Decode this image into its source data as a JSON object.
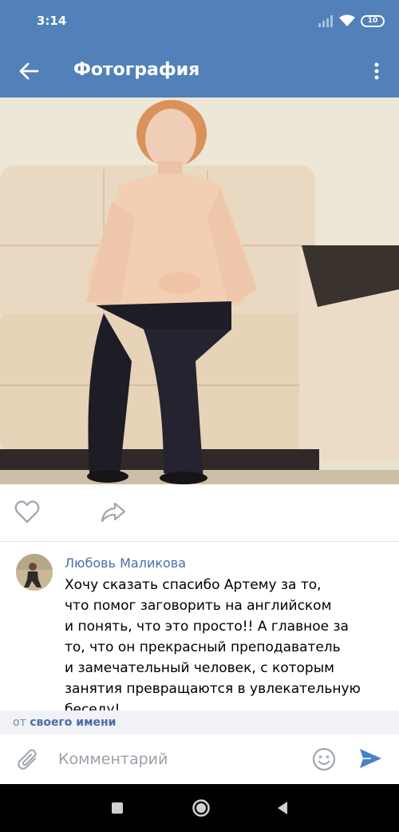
{
  "status_bar": {
    "time": "3:14",
    "battery": "10",
    "icons": [
      "signal-icon",
      "wifi-icon",
      "battery-icon"
    ]
  },
  "toolbar": {
    "title": "Фотография",
    "back_icon": "arrow-left-icon",
    "menu_icon": "more-vertical-icon"
  },
  "photo": {
    "description_icon": "photo-image"
  },
  "actions": {
    "like_icon": "heart-icon",
    "share_icon": "share-icon"
  },
  "comment": {
    "author": "Любовь Маликова",
    "text": "Хочу сказать спасибо Артему за то,\nчто помог заговорить на английском\nи понять, что это просто!! А главное за\nто, что он прекрасный преподаватель\nи замечательный человек, с которым\nзанятия превращаются в увлекательную\nбеседу!"
  },
  "from_bar": {
    "prefix": "от",
    "link": "своего имени"
  },
  "composer": {
    "placeholder": "Комментарий",
    "value": "",
    "attach_icon": "paperclip-icon",
    "emoji_icon": "smile-icon",
    "send_icon": "send-icon"
  },
  "nav": {
    "icons": [
      "recent-apps-icon",
      "home-icon",
      "back-icon"
    ]
  },
  "colors": {
    "header": "#5181b8",
    "link": "#4a6ea8",
    "icon_gray": "#a0a8b3",
    "send": "#4a80c8"
  }
}
